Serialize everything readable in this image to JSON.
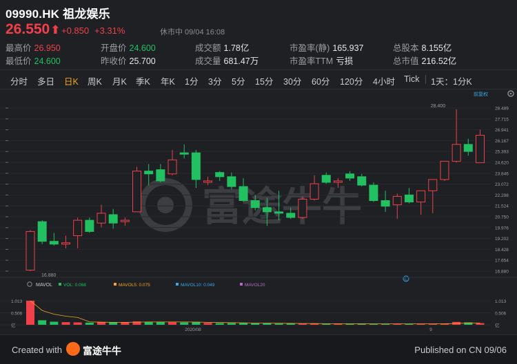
{
  "header": {
    "title": "09990.HK 祖龙娱乐",
    "price": "26.550",
    "change": "+0.850",
    "change_pct": "+3.31%",
    "status": "休市中 09/04 16:08"
  },
  "stats": {
    "high": {
      "label": "最高价",
      "value": "26.950"
    },
    "low": {
      "label": "最低价",
      "value": "24.600"
    },
    "open": {
      "label": "开盘价",
      "value": "24.600"
    },
    "prev_close": {
      "label": "昨收价",
      "value": "25.700"
    },
    "turnover": {
      "label": "成交额",
      "value": "1.78亿"
    },
    "volume": {
      "label": "成交量",
      "value": "681.47万"
    },
    "pe_static": {
      "label": "市盈率(静)",
      "value": "165.937"
    },
    "pe_ttm": {
      "label": "市盈率TTM",
      "value": "亏损"
    },
    "total_shares": {
      "label": "总股本",
      "value": "8.155亿"
    },
    "market_cap": {
      "label": "总市值",
      "value": "216.52亿"
    }
  },
  "tabs": [
    "分时",
    "多日",
    "日K",
    "周K",
    "月K",
    "季K",
    "年K",
    "1分",
    "3分",
    "5分",
    "15分",
    "30分",
    "60分",
    "120分",
    "4小时",
    "Tick",
    "1天：1分K"
  ],
  "active_tab": "日K",
  "colors": {
    "up": "#f0414a",
    "down": "#23c061",
    "accent": "#f5a623",
    "bg": "#1e2024"
  },
  "chart_data": {
    "type": "candlestick",
    "adjust_label": "前复权",
    "y_ticks": [
      "28.489",
      "27.715",
      "26.941",
      "26.167",
      "25.393",
      "24.620",
      "23.846",
      "23.072",
      "22.298",
      "21.524",
      "20.750",
      "19.976",
      "19.202",
      "18.428",
      "17.654",
      "16.880"
    ],
    "ylim": [
      16.88,
      28.489
    ],
    "max_label": "28.400",
    "min_label": "16.880",
    "candles": [
      {
        "o": 16.95,
        "h": 19.8,
        "l": 16.88,
        "c": 19.7
      },
      {
        "o": 20.4,
        "h": 20.5,
        "l": 18.8,
        "c": 19.0
      },
      {
        "o": 19.0,
        "h": 19.6,
        "l": 18.7,
        "c": 18.8
      },
      {
        "o": 18.8,
        "h": 19.4,
        "l": 18.5,
        "c": 18.9
      },
      {
        "o": 19.4,
        "h": 20.7,
        "l": 18.5,
        "c": 20.5
      },
      {
        "o": 20.5,
        "h": 20.7,
        "l": 19.6,
        "c": 19.7
      },
      {
        "o": 20.3,
        "h": 21.6,
        "l": 20.0,
        "c": 21.0
      },
      {
        "o": 20.9,
        "h": 21.3,
        "l": 19.9,
        "c": 20.3
      },
      {
        "o": 20.4,
        "h": 20.7,
        "l": 20.1,
        "c": 20.5
      },
      {
        "o": 21.1,
        "h": 24.3,
        "l": 21.1,
        "c": 24.0
      },
      {
        "o": 24.0,
        "h": 24.5,
        "l": 23.0,
        "c": 23.8
      },
      {
        "o": 24.1,
        "h": 24.5,
        "l": 23.2,
        "c": 23.3
      },
      {
        "o": 23.8,
        "h": 25.5,
        "l": 23.7,
        "c": 24.8
      },
      {
        "o": 25.3,
        "h": 25.9,
        "l": 24.9,
        "c": 25.2
      },
      {
        "o": 25.3,
        "h": 25.5,
        "l": 22.8,
        "c": 23.4
      },
      {
        "o": 23.2,
        "h": 23.6,
        "l": 23.0,
        "c": 23.3
      },
      {
        "o": 23.9,
        "h": 24.0,
        "l": 23.3,
        "c": 23.6
      },
      {
        "o": 23.6,
        "h": 23.9,
        "l": 22.7,
        "c": 22.9
      },
      {
        "o": 22.9,
        "h": 23.5,
        "l": 21.8,
        "c": 21.9
      },
      {
        "o": 21.9,
        "h": 22.3,
        "l": 21.2,
        "c": 21.4
      },
      {
        "o": 21.4,
        "h": 22.1,
        "l": 20.1,
        "c": 21.1
      },
      {
        "o": 21.1,
        "h": 22.6,
        "l": 20.5,
        "c": 21.0
      },
      {
        "o": 21.0,
        "h": 21.4,
        "l": 20.6,
        "c": 20.7
      },
      {
        "o": 20.7,
        "h": 22.2,
        "l": 20.6,
        "c": 22.0
      },
      {
        "o": 22.0,
        "h": 23.7,
        "l": 21.9,
        "c": 23.1
      },
      {
        "o": 23.7,
        "h": 23.9,
        "l": 23.1,
        "c": 23.2
      },
      {
        "o": 23.2,
        "h": 23.5,
        "l": 22.8,
        "c": 23.3
      },
      {
        "o": 23.8,
        "h": 24.0,
        "l": 23.3,
        "c": 23.5
      },
      {
        "o": 23.6,
        "h": 23.8,
        "l": 22.9,
        "c": 23.0
      },
      {
        "o": 23.0,
        "h": 23.2,
        "l": 21.8,
        "c": 21.9
      },
      {
        "o": 21.9,
        "h": 22.6,
        "l": 21.1,
        "c": 21.5
      },
      {
        "o": 21.6,
        "h": 22.4,
        "l": 20.6,
        "c": 22.2
      },
      {
        "o": 22.3,
        "h": 22.8,
        "l": 21.7,
        "c": 21.8
      },
      {
        "o": 21.8,
        "h": 22.5,
        "l": 20.9,
        "c": 22.6
      },
      {
        "o": 22.6,
        "h": 23.4,
        "l": 21.0,
        "c": 23.4
      },
      {
        "o": 23.4,
        "h": 23.9,
        "l": 23.3,
        "c": 24.7
      },
      {
        "o": 24.7,
        "h": 28.4,
        "l": 24.6,
        "c": 25.9
      },
      {
        "o": 25.9,
        "h": 26.3,
        "l": 25.1,
        "c": 25.4
      },
      {
        "o": 24.6,
        "h": 26.95,
        "l": 24.6,
        "c": 26.55
      }
    ],
    "indicator": {
      "name": "MAVOL",
      "legend": [
        {
          "label": "VOL: 0.068",
          "color": "#23c061"
        },
        {
          "label": "MAVOL5: 0.075",
          "color": "#f5a623"
        },
        {
          "label": "MAVOL10: 0.049",
          "color": "#3aa8e8"
        },
        {
          "label": "MAVOL20",
          "color": "#b46ec8"
        }
      ],
      "y_ticks": [
        "1.013",
        "0.506",
        "亿"
      ],
      "x_labels": [
        "2020/08",
        "9"
      ],
      "volumes": [
        1.013,
        0.19,
        0.13,
        0.11,
        0.1,
        0.09,
        0.12,
        0.11,
        0.1,
        0.14,
        0.13,
        0.12,
        0.11,
        0.1,
        0.12,
        0.08,
        0.07,
        0.07,
        0.08,
        0.06,
        0.06,
        0.05,
        0.05,
        0.05,
        0.05,
        0.04,
        0.04,
        0.04,
        0.04,
        0.04,
        0.04,
        0.04,
        0.04,
        0.04,
        0.04,
        0.05,
        0.12,
        0.1,
        0.068
      ]
    }
  },
  "footer": {
    "created_with": "Created with",
    "brand": "富途牛牛",
    "published": "Published on CN 09/06"
  },
  "watermark": {
    "text": "富途牛牛"
  }
}
